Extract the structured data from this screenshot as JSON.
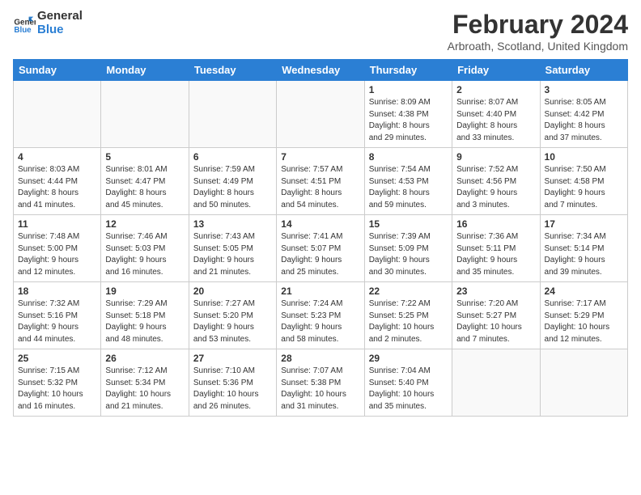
{
  "logo": {
    "line1": "General",
    "line2": "Blue"
  },
  "title": "February 2024",
  "location": "Arbroath, Scotland, United Kingdom",
  "days_of_week": [
    "Sunday",
    "Monday",
    "Tuesday",
    "Wednesday",
    "Thursday",
    "Friday",
    "Saturday"
  ],
  "weeks": [
    [
      {
        "day": "",
        "info": ""
      },
      {
        "day": "",
        "info": ""
      },
      {
        "day": "",
        "info": ""
      },
      {
        "day": "",
        "info": ""
      },
      {
        "day": "1",
        "info": "Sunrise: 8:09 AM\nSunset: 4:38 PM\nDaylight: 8 hours\nand 29 minutes."
      },
      {
        "day": "2",
        "info": "Sunrise: 8:07 AM\nSunset: 4:40 PM\nDaylight: 8 hours\nand 33 minutes."
      },
      {
        "day": "3",
        "info": "Sunrise: 8:05 AM\nSunset: 4:42 PM\nDaylight: 8 hours\nand 37 minutes."
      }
    ],
    [
      {
        "day": "4",
        "info": "Sunrise: 8:03 AM\nSunset: 4:44 PM\nDaylight: 8 hours\nand 41 minutes."
      },
      {
        "day": "5",
        "info": "Sunrise: 8:01 AM\nSunset: 4:47 PM\nDaylight: 8 hours\nand 45 minutes."
      },
      {
        "day": "6",
        "info": "Sunrise: 7:59 AM\nSunset: 4:49 PM\nDaylight: 8 hours\nand 50 minutes."
      },
      {
        "day": "7",
        "info": "Sunrise: 7:57 AM\nSunset: 4:51 PM\nDaylight: 8 hours\nand 54 minutes."
      },
      {
        "day": "8",
        "info": "Sunrise: 7:54 AM\nSunset: 4:53 PM\nDaylight: 8 hours\nand 59 minutes."
      },
      {
        "day": "9",
        "info": "Sunrise: 7:52 AM\nSunset: 4:56 PM\nDaylight: 9 hours\nand 3 minutes."
      },
      {
        "day": "10",
        "info": "Sunrise: 7:50 AM\nSunset: 4:58 PM\nDaylight: 9 hours\nand 7 minutes."
      }
    ],
    [
      {
        "day": "11",
        "info": "Sunrise: 7:48 AM\nSunset: 5:00 PM\nDaylight: 9 hours\nand 12 minutes."
      },
      {
        "day": "12",
        "info": "Sunrise: 7:46 AM\nSunset: 5:03 PM\nDaylight: 9 hours\nand 16 minutes."
      },
      {
        "day": "13",
        "info": "Sunrise: 7:43 AM\nSunset: 5:05 PM\nDaylight: 9 hours\nand 21 minutes."
      },
      {
        "day": "14",
        "info": "Sunrise: 7:41 AM\nSunset: 5:07 PM\nDaylight: 9 hours\nand 25 minutes."
      },
      {
        "day": "15",
        "info": "Sunrise: 7:39 AM\nSunset: 5:09 PM\nDaylight: 9 hours\nand 30 minutes."
      },
      {
        "day": "16",
        "info": "Sunrise: 7:36 AM\nSunset: 5:11 PM\nDaylight: 9 hours\nand 35 minutes."
      },
      {
        "day": "17",
        "info": "Sunrise: 7:34 AM\nSunset: 5:14 PM\nDaylight: 9 hours\nand 39 minutes."
      }
    ],
    [
      {
        "day": "18",
        "info": "Sunrise: 7:32 AM\nSunset: 5:16 PM\nDaylight: 9 hours\nand 44 minutes."
      },
      {
        "day": "19",
        "info": "Sunrise: 7:29 AM\nSunset: 5:18 PM\nDaylight: 9 hours\nand 48 minutes."
      },
      {
        "day": "20",
        "info": "Sunrise: 7:27 AM\nSunset: 5:20 PM\nDaylight: 9 hours\nand 53 minutes."
      },
      {
        "day": "21",
        "info": "Sunrise: 7:24 AM\nSunset: 5:23 PM\nDaylight: 9 hours\nand 58 minutes."
      },
      {
        "day": "22",
        "info": "Sunrise: 7:22 AM\nSunset: 5:25 PM\nDaylight: 10 hours\nand 2 minutes."
      },
      {
        "day": "23",
        "info": "Sunrise: 7:20 AM\nSunset: 5:27 PM\nDaylight: 10 hours\nand 7 minutes."
      },
      {
        "day": "24",
        "info": "Sunrise: 7:17 AM\nSunset: 5:29 PM\nDaylight: 10 hours\nand 12 minutes."
      }
    ],
    [
      {
        "day": "25",
        "info": "Sunrise: 7:15 AM\nSunset: 5:32 PM\nDaylight: 10 hours\nand 16 minutes."
      },
      {
        "day": "26",
        "info": "Sunrise: 7:12 AM\nSunset: 5:34 PM\nDaylight: 10 hours\nand 21 minutes."
      },
      {
        "day": "27",
        "info": "Sunrise: 7:10 AM\nSunset: 5:36 PM\nDaylight: 10 hours\nand 26 minutes."
      },
      {
        "day": "28",
        "info": "Sunrise: 7:07 AM\nSunset: 5:38 PM\nDaylight: 10 hours\nand 31 minutes."
      },
      {
        "day": "29",
        "info": "Sunrise: 7:04 AM\nSunset: 5:40 PM\nDaylight: 10 hours\nand 35 minutes."
      },
      {
        "day": "",
        "info": ""
      },
      {
        "day": "",
        "info": ""
      }
    ]
  ]
}
